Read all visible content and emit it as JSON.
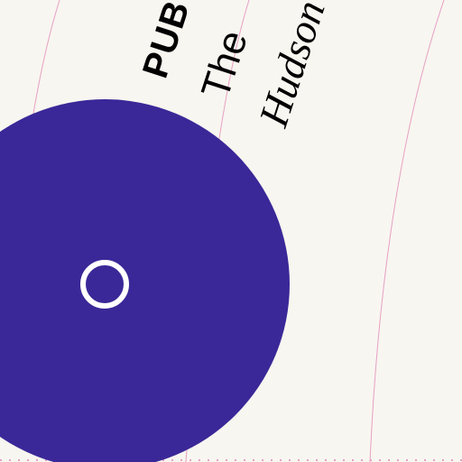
{
  "colors": {
    "background": "#f8f6f0",
    "disc": "#3a2898",
    "spindle_ring": "#ffffff",
    "guide_lines": "#e6a0c4",
    "text": "#000000"
  },
  "labels": {
    "publisher": "PUB",
    "line1": "The",
    "line2": "Hudson"
  }
}
